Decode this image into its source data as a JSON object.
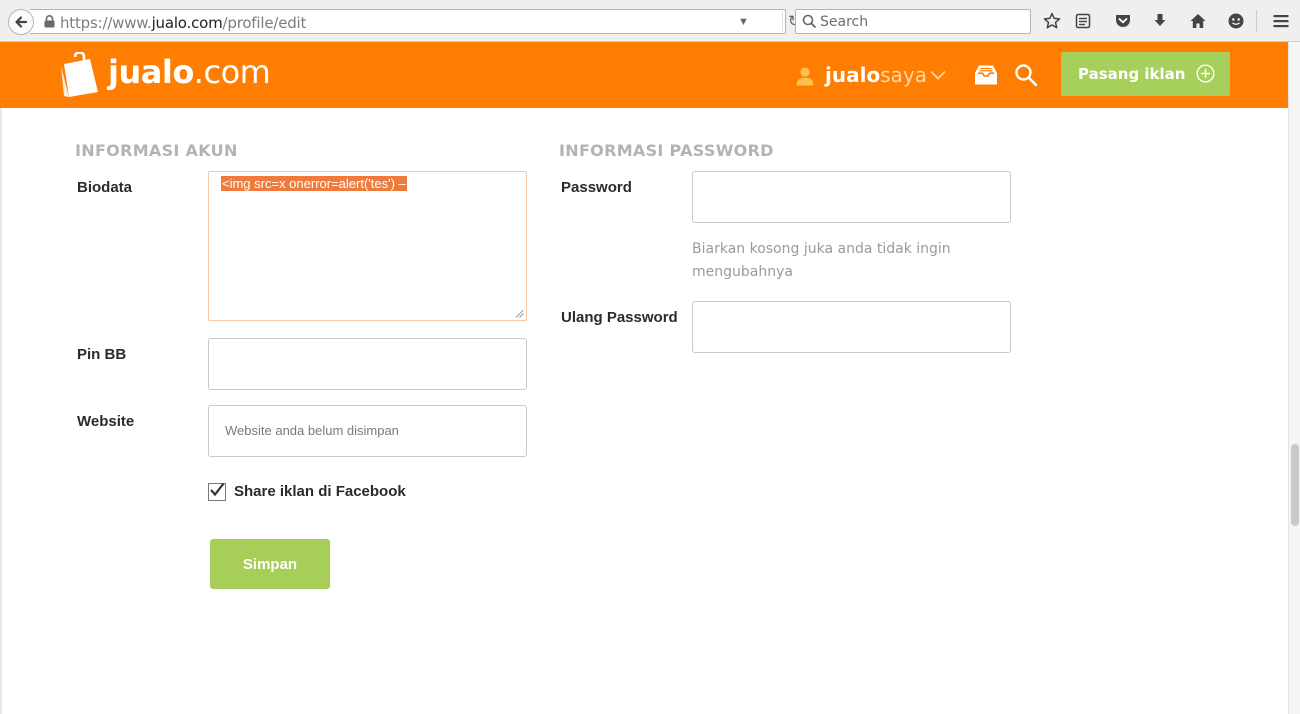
{
  "browser": {
    "url_prefix": "https://www.",
    "url_host": "jualo.com",
    "url_path": "/profile/edit",
    "search_placeholder": "Search"
  },
  "header": {
    "logo_bold": "jualo",
    "logo_light": ".com",
    "user_bold": "jualo",
    "user_light": "saya",
    "post_ad_label": "Pasang iklan"
  },
  "account": {
    "section_title": "INFORMASI AKUN",
    "biodata_label": "Biodata",
    "biodata_value": "<img src=x onerror=alert('tes') –",
    "pinbb_label": "Pin BB",
    "pinbb_value": "",
    "website_label": "Website",
    "website_placeholder": "Website anda belum disimpan",
    "share_label": "Share iklan di Facebook",
    "share_checked": true,
    "save_label": "Simpan"
  },
  "password": {
    "section_title": "INFORMASI PASSWORD",
    "password_label": "Password",
    "password_hint": "Biarkan kosong juka anda tidak ingin mengubahnya",
    "repeat_label": "Ulang Password"
  },
  "colors": {
    "brand_orange": "#ff7d00",
    "accent_green": "#a7cf5b",
    "selection": "#f07a3c"
  }
}
